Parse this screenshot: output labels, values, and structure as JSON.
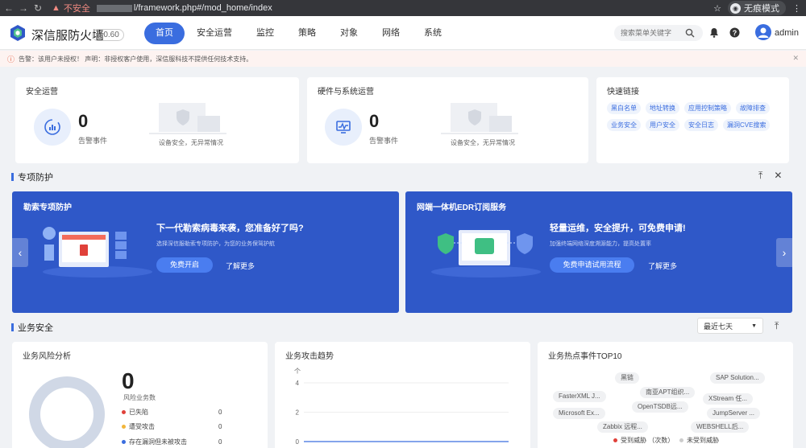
{
  "browser": {
    "insecure_label": "不安全",
    "url": "l/framework.php#/mod_home/index",
    "incognito_label": "无痕模式"
  },
  "header": {
    "brand": "深信服防火墙",
    "version": "8.0.60",
    "menu": [
      "首页",
      "安全运营",
      "监控",
      "策略",
      "对象",
      "网络",
      "系统"
    ],
    "search_placeholder": "搜索菜单关键字",
    "user": "admin"
  },
  "warning": {
    "text": "告警：该用户未授权！   声明：非授权客户使用，深信服科技不提供任何技术支持。"
  },
  "security_ops": {
    "title": "安全运营",
    "count": "0",
    "count_label": "告警事件",
    "status": "设备安全，无异常情况"
  },
  "hw_ops": {
    "title": "硬件与系统运营",
    "count": "0",
    "count_label": "告警事件",
    "status": "设备安全，无异常情况"
  },
  "quick_links": {
    "title": "快速链接",
    "items": [
      "黑白名单",
      "地址转换",
      "应用控制策略",
      "故障排查",
      "业务安全",
      "用户安全",
      "安全日志",
      "漏洞CVE搜索"
    ]
  },
  "special": {
    "title": "专项防护",
    "banners": [
      {
        "title": "勒索专项防护",
        "headline": "下一代勒索病毒来袭，您准备好了吗?",
        "desc": "选择深信服勒索专项防护，为您的业务保驾护航",
        "primary": "免费开启",
        "more": "了解更多"
      },
      {
        "title": "网端一体机EDR订阅服务",
        "headline": "轻量运维，安全提升，可免费申请!",
        "desc": "加强终端网络深度溯源能力，提高处置率",
        "primary": "免费申请试用流程",
        "more": "了解更多"
      }
    ]
  },
  "business": {
    "title": "业务安全",
    "range": "最近七天",
    "risk": {
      "title": "业务风险分析",
      "count": "0",
      "count_label": "风险业务数",
      "rows": [
        {
          "label": "已失陷",
          "value": "0",
          "color": "#e0413a"
        },
        {
          "label": "遭受攻击",
          "value": "0",
          "color": "#f2b63c"
        },
        {
          "label": "存在漏洞但未被攻击",
          "value": "0",
          "color": "#3a6ddf"
        }
      ]
    },
    "trend": {
      "title": "业务攻击趋势",
      "unit": "个"
    },
    "top10": {
      "title": "业务热点事件TOP10",
      "tags": [
        "黑链",
        "SAP Solution...",
        "FasterXML J...",
        "南亚APT组织...",
        "XStream 任...",
        "Microsoft Ex...",
        "OpenTSDB远...",
        "JumpServer ...",
        "Zabbix 远程...",
        "WEBSHELL后..."
      ],
      "legend": [
        "受到威胁 （次数）",
        "未受到威胁"
      ]
    }
  },
  "chart_data": {
    "type": "line",
    "title": "业务攻击趋势",
    "ylabel": "个",
    "yticks": [
      0,
      2,
      4
    ],
    "ylim": [
      0,
      4
    ],
    "series": [
      {
        "values": [
          0,
          0,
          0,
          0,
          0,
          0,
          0
        ]
      }
    ]
  },
  "colors": {
    "accent": "#3a6ddf",
    "banner": "#2f58c8",
    "danger": "#e0413a"
  }
}
